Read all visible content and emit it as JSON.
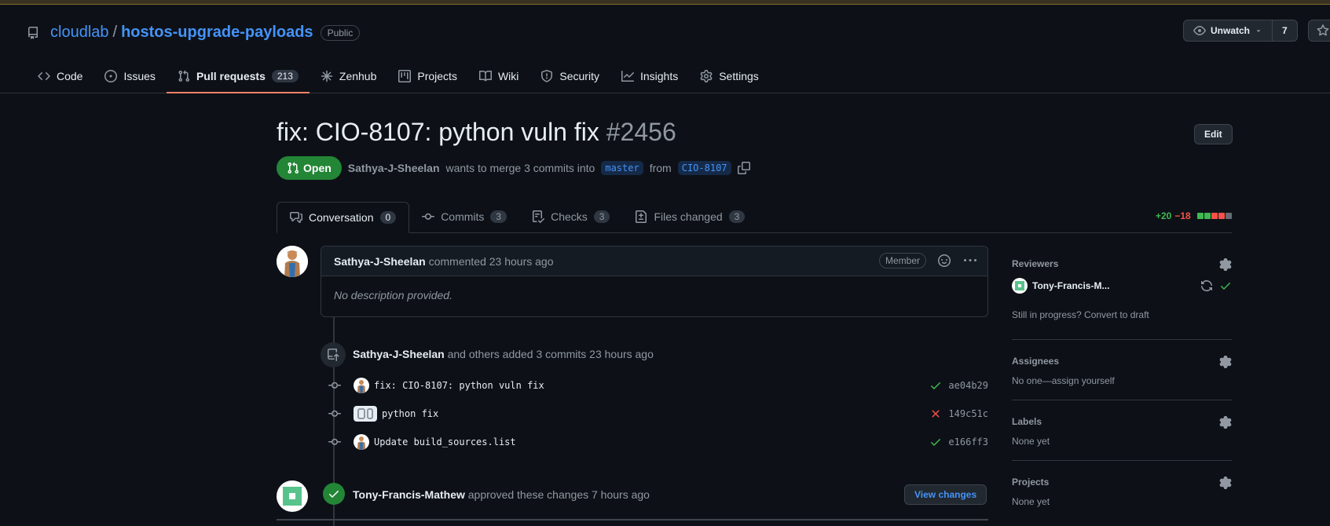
{
  "repo": {
    "owner": "cloudlab",
    "separator": "/",
    "name": "hostos-upgrade-payloads",
    "visibility": "Public"
  },
  "watch": {
    "label": "Unwatch",
    "count": "7"
  },
  "nav": [
    {
      "label": "Code",
      "icon": "code-icon"
    },
    {
      "label": "Issues",
      "icon": "issue-icon"
    },
    {
      "label": "Pull requests",
      "icon": "pull-request-icon",
      "count": "213",
      "active": true
    },
    {
      "label": "Zenhub",
      "icon": "zenhub-icon"
    },
    {
      "label": "Projects",
      "icon": "project-icon"
    },
    {
      "label": "Wiki",
      "icon": "book-icon"
    },
    {
      "label": "Security",
      "icon": "shield-icon"
    },
    {
      "label": "Insights",
      "icon": "graph-icon"
    },
    {
      "label": "Settings",
      "icon": "gear-icon"
    }
  ],
  "pr": {
    "title": "fix: CIO-8107: python vuln fix",
    "number": "#2456",
    "edit_label": "Edit",
    "state": "Open",
    "author": "Sathya-J-Sheelan",
    "merge_text": "wants to merge 3 commits into",
    "base_branch": "master",
    "from_text": "from",
    "head_branch": "CIO-8107"
  },
  "tabs": [
    {
      "label": "Conversation",
      "count": "0",
      "icon": "comment-discussion-icon"
    },
    {
      "label": "Commits",
      "count": "3",
      "icon": "commit-icon"
    },
    {
      "label": "Checks",
      "count": "3",
      "icon": "checklist-icon"
    },
    {
      "label": "Files changed",
      "count": "3",
      "icon": "file-diff-icon"
    }
  ],
  "diffstat": {
    "additions": "+20",
    "deletions": "−18",
    "blocks": [
      "#3fb950",
      "#3fb950",
      "#f85149",
      "#f85149",
      "#656c76"
    ]
  },
  "comment": {
    "author": "Sathya-J-Sheelan",
    "meta": "commented 23 hours ago",
    "role": "Member",
    "body": "No description provided."
  },
  "commits_event": {
    "author": "Sathya-J-Sheelan",
    "text": "and others added 3 commits 23 hours ago"
  },
  "commits": [
    {
      "message": "fix: CIO-8107: python vuln fix",
      "sha": "ae04b29",
      "status": "success"
    },
    {
      "message": "python fix",
      "sha": "149c51c",
      "status": "failure"
    },
    {
      "message": "Update build_sources.list",
      "sha": "e166ff3",
      "status": "success"
    }
  ],
  "review_event": {
    "author": "Tony-Francis-Mathew",
    "text": "approved these changes 7 hours ago",
    "button": "View changes"
  },
  "sidebar": {
    "reviewers": {
      "title": "Reviewers",
      "name": "Tony-Francis-M...",
      "draft_text": "Still in progress? Convert to draft"
    },
    "assignees": {
      "title": "Assignees",
      "value": "No one—assign yourself"
    },
    "labels": {
      "title": "Labels",
      "value": "None yet"
    },
    "projects": {
      "title": "Projects",
      "value": "None yet"
    }
  },
  "colors": {
    "accent": "#4493f8",
    "open": "#238636",
    "underline": "#f78166",
    "success": "#3fb950",
    "danger": "#f85149"
  }
}
